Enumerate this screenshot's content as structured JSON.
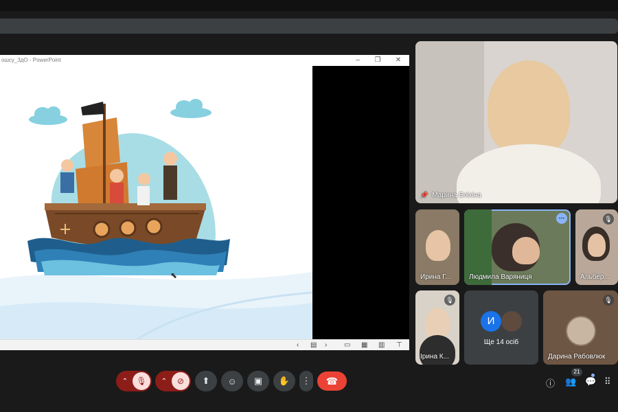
{
  "presentation": {
    "window_title": "ошсу_3дО - PowerPoint",
    "window_controls": [
      "–",
      "❐",
      "✕"
    ],
    "status_icons": [
      "‹",
      "▤",
      "›",
      "▭",
      "▦",
      "▥",
      "⊤"
    ]
  },
  "participants": {
    "main": {
      "name": "Марина Епіхіна",
      "pinned": true
    },
    "grid": [
      {
        "name": "Ирина Г...",
        "muted": false
      },
      {
        "name": "Людмила Варяниця",
        "muted": false,
        "active": true
      },
      {
        "name": "Альбер...",
        "muted": true
      },
      {
        "name": "Ірина К...",
        "muted": true
      },
      {
        "name": "Дарина Рабовлюк",
        "muted": true
      }
    ],
    "others": {
      "avatar_letter": "И",
      "label": "Ще 14 осіб",
      "avatar_color": "#1a73e8"
    }
  },
  "toolbar": {
    "mic_icon": "mic-off",
    "cam_icon": "camera-off",
    "present_icon": "present",
    "emoji_icon": "emoji",
    "captions_icon": "captions",
    "hand_icon": "raise-hand",
    "more_icon": "more",
    "end_icon": "end-call"
  },
  "side_toolbar": {
    "people_count": "21"
  },
  "colors": {
    "end_call": "#ea4335",
    "muted_bg": "#8c1d18",
    "accent": "#8ab4f8"
  }
}
